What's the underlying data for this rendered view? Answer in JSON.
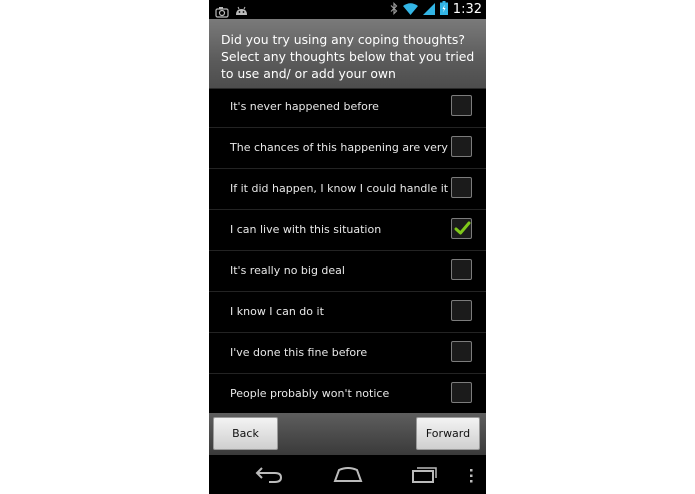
{
  "status_bar": {
    "time": "1:32",
    "icons": [
      "camera-icon",
      "android-icon",
      "bluetooth-icon",
      "wifi-icon",
      "signal-icon",
      "battery-icon"
    ]
  },
  "header": {
    "title": "Did you try using any coping thoughts? Select any thoughts below that you tried to use and/ or add your own"
  },
  "thoughts": [
    {
      "label": "It's never happened before",
      "checked": false
    },
    {
      "label": "The chances of this happening are very low",
      "checked": false
    },
    {
      "label": "If it did happen, I know I could handle it",
      "checked": false
    },
    {
      "label": "I can live with this situation",
      "checked": true
    },
    {
      "label": "It's really no big deal",
      "checked": false
    },
    {
      "label": "I know I can do it",
      "checked": false
    },
    {
      "label": "I've done this fine before",
      "checked": false
    },
    {
      "label": "People probably won't notice",
      "checked": false
    }
  ],
  "buttons": {
    "back": "Back",
    "forward": "Forward"
  },
  "nav_bar": {
    "icons": [
      "back-nav-icon",
      "home-nav-icon",
      "recents-nav-icon",
      "overflow-menu-icon"
    ]
  },
  "colors": {
    "check": "#7fc81a",
    "background": "#000000"
  }
}
